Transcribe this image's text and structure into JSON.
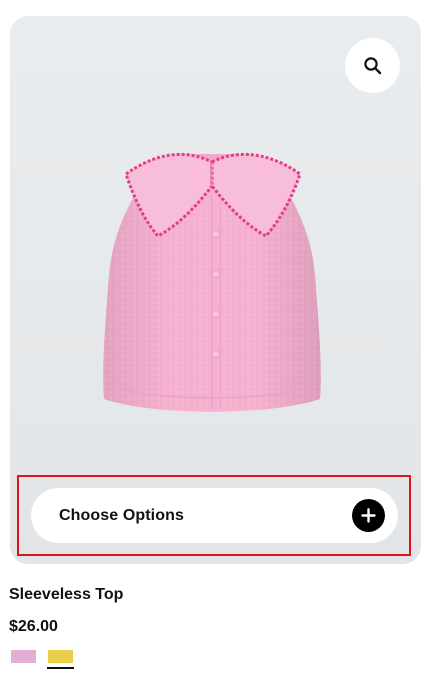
{
  "product": {
    "title": "Sleeveless Top",
    "price": "$26.00",
    "image_alt": "Pink sleeveless top with ric-rac trimmed collar"
  },
  "actions": {
    "zoom_icon": "search-icon",
    "choose_options_label": "Choose Options",
    "choose_options_icon": "plus-icon"
  },
  "swatches": [
    {
      "name": "pink",
      "color": "#e3aed3",
      "selected": false
    },
    {
      "name": "yellow",
      "color": "#e9cf4a",
      "selected": true
    }
  ],
  "colors": {
    "card_background": "#e7eaec",
    "highlight_border": "#e0141c",
    "button_background": "#ffffff",
    "plus_circle": "#000000"
  }
}
